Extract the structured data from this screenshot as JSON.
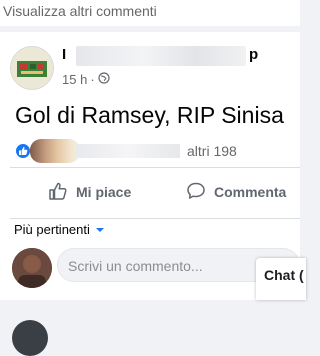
{
  "top": {
    "view_more_comments": "Visualizza altri commenti"
  },
  "post": {
    "author_first": "I",
    "author_last": "p",
    "time": "15 h",
    "separator": "·",
    "privacy_icon": "globe-icon",
    "text": "Gol di Ramsey, RIP Sinisa"
  },
  "reactions": {
    "icon": "like-icon",
    "others_count": "altri 198"
  },
  "actions": {
    "like_label": "Mi piace",
    "comment_label": "Commenta"
  },
  "comments": {
    "sort_label": "Più pertinenti",
    "sort_icon": "caret-down-icon",
    "placeholder": "Scrivi un commento..."
  },
  "chat": {
    "label": "Chat ("
  },
  "colors": {
    "brand_blue": "#1877f2",
    "text_secondary": "#65676b",
    "divider": "#dadde1"
  }
}
